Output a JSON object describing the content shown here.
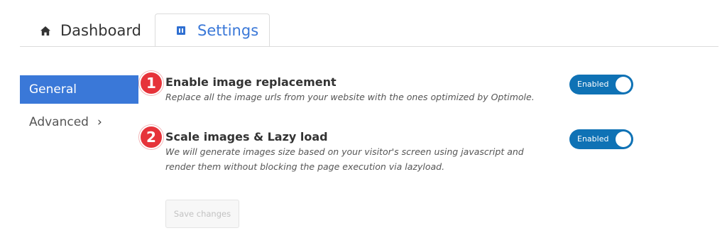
{
  "tabs": {
    "dashboard": {
      "label": "Dashboard",
      "icon": "house-icon"
    },
    "settings": {
      "label": "Settings",
      "icon": "settings-icon",
      "active": true
    }
  },
  "sidebar": {
    "items": [
      {
        "label": "General",
        "active": true
      },
      {
        "label": "Advanced",
        "icon": "chevron-right-icon"
      }
    ]
  },
  "settings": [
    {
      "badge": "1",
      "title": "Enable image replacement",
      "description": "Replace all the image urls from your website with the ones optimized by Optimole.",
      "toggle_label": "Enabled",
      "toggle_on": true
    },
    {
      "badge": "2",
      "title": "Scale images & Lazy load",
      "description": "We will generate images size based on your visitor's screen using javascript and render them without blocking the page execution via lazyload.",
      "toggle_label": "Enabled",
      "toggle_on": true
    }
  ],
  "save_button": {
    "label": "Save changes",
    "disabled": true
  },
  "colors": {
    "accent": "#3a78d8",
    "toggle_on": "#0f72b5",
    "badge": "#e6333a"
  }
}
